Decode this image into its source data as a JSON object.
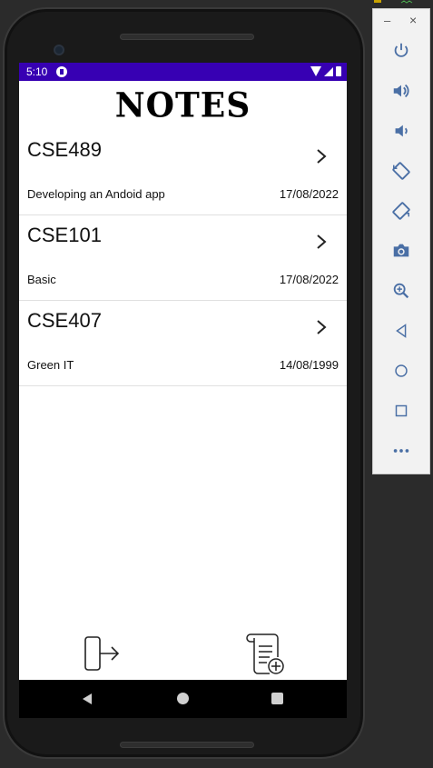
{
  "status_bar": {
    "time": "5:10"
  },
  "app": {
    "title": "NOTES"
  },
  "notes": [
    {
      "title": "CSE489",
      "description": "Developing an Andoid app",
      "date": "17/08/2022"
    },
    {
      "title": "CSE101",
      "description": "Basic",
      "date": "17/08/2022"
    },
    {
      "title": "CSE407",
      "description": "Green IT",
      "date": "14/08/1999"
    }
  ],
  "actions": {
    "logout_icon": "logout-icon",
    "add_note_icon": "add-note-icon"
  },
  "nav": {
    "back_icon": "back-icon",
    "home_icon": "home-icon",
    "recent_icon": "recent-apps-icon"
  },
  "emulator_toolbar": {
    "minimize": "–",
    "close": "×",
    "buttons": [
      "power-icon",
      "volume-up-icon",
      "volume-down-icon",
      "rotate-left-icon",
      "rotate-right-icon",
      "camera-icon",
      "zoom-icon",
      "back-icon",
      "home-icon",
      "overview-icon",
      "more-icon"
    ]
  },
  "colors": {
    "status_bar": "#3700b3",
    "screen_bg": "#ffffff",
    "divider": "#e0e0e0",
    "emulator_icon": "#4a6fa5"
  }
}
